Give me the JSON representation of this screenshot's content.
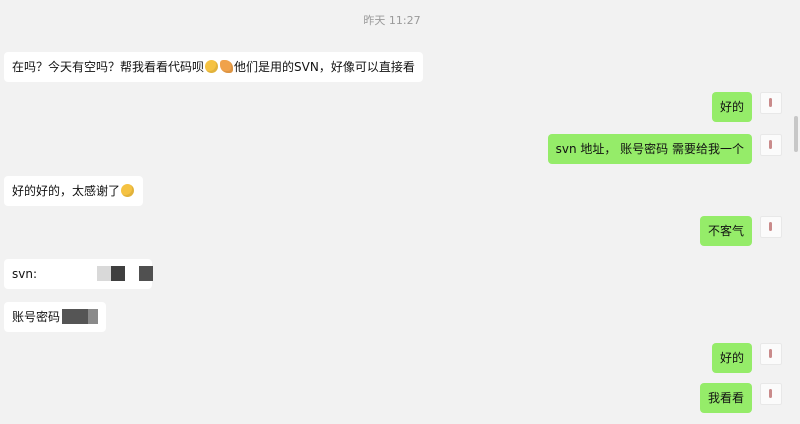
{
  "chat": {
    "timestamp": "昨天 11:27",
    "messages": [
      {
        "id": "m1",
        "side": "left",
        "text_before": "在吗？今天有空吗？帮我看看代码呗",
        "text_after": "他们是用的SVN，好像可以直接看"
      },
      {
        "id": "m2",
        "side": "right",
        "text": "好的"
      },
      {
        "id": "m3",
        "side": "right",
        "text": "svn 地址， 账号密码 需要给我一个"
      },
      {
        "id": "m4",
        "side": "left",
        "text": "好的好的，太感谢了"
      },
      {
        "id": "m5",
        "side": "right",
        "text": "不客气"
      },
      {
        "id": "m6",
        "side": "left",
        "text": "svn:"
      },
      {
        "id": "m7",
        "side": "left",
        "text": "账号密码"
      },
      {
        "id": "m8",
        "side": "right",
        "text": "好的"
      },
      {
        "id": "m9",
        "side": "right",
        "text": "我看看"
      }
    ]
  },
  "icons": {
    "emoji_face": "smiling-face-emoji-icon",
    "emoji_hands": "folded-hands-emoji-icon",
    "avatar": "user-avatar"
  },
  "colors": {
    "background": "#f2f2f2",
    "incoming_bubble": "#ffffff",
    "outgoing_bubble": "#95ec69",
    "timestamp_text": "#9a9a9a"
  }
}
